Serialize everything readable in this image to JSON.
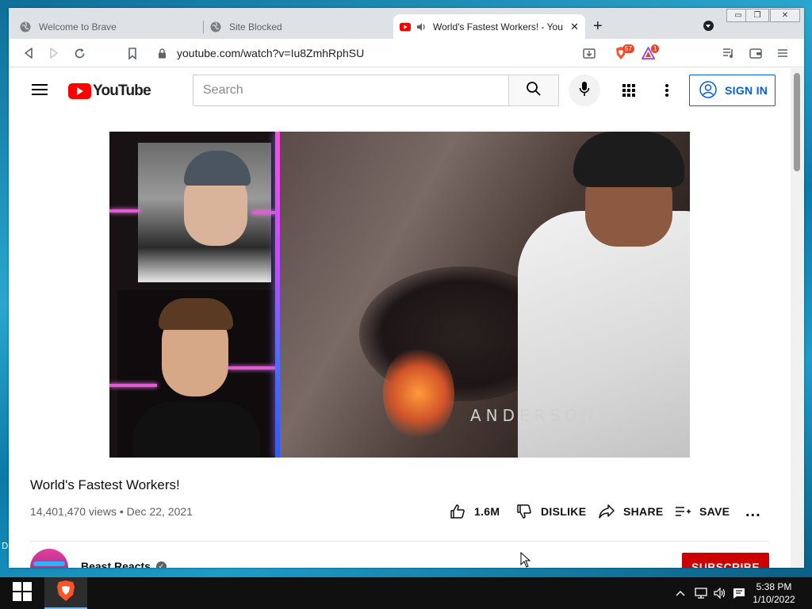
{
  "desktop": {
    "partial_label": "D"
  },
  "browser": {
    "tabs": [
      {
        "title": "Welcome to Brave",
        "active": false
      },
      {
        "title": "Site Blocked",
        "active": false
      },
      {
        "title": "World's Fastest Workers! - You",
        "active": true
      }
    ],
    "new_tab": "+",
    "tab_close": "✕",
    "window_controls": {
      "minimize": "▭",
      "restore": "❐",
      "close": "✕"
    },
    "url": "youtube.com/watch?v=Iu8ZmhRphSU",
    "shields_badge": "57",
    "rewards_badge": "1"
  },
  "youtube": {
    "logo_text": "YouTube",
    "search_placeholder": "Search",
    "sign_in": "SIGN IN"
  },
  "video": {
    "overlay_text": "ANDERSON",
    "title": "World's Fastest Workers!",
    "views": "14,401,470 views",
    "date": "Dec 22, 2021",
    "likes": "1.6M",
    "dislike": "DISLIKE",
    "share": "SHARE",
    "save": "SAVE",
    "more": "..."
  },
  "channel": {
    "name": "Beast Reacts",
    "subscribe": "SUBSCRIBE"
  },
  "taskbar": {
    "time": "5:38 PM",
    "date": "1/10/2022"
  },
  "colors": {
    "youtube_red": "#ff0000",
    "subscribe_red": "#cc0000",
    "signin_blue": "#065fd4"
  }
}
